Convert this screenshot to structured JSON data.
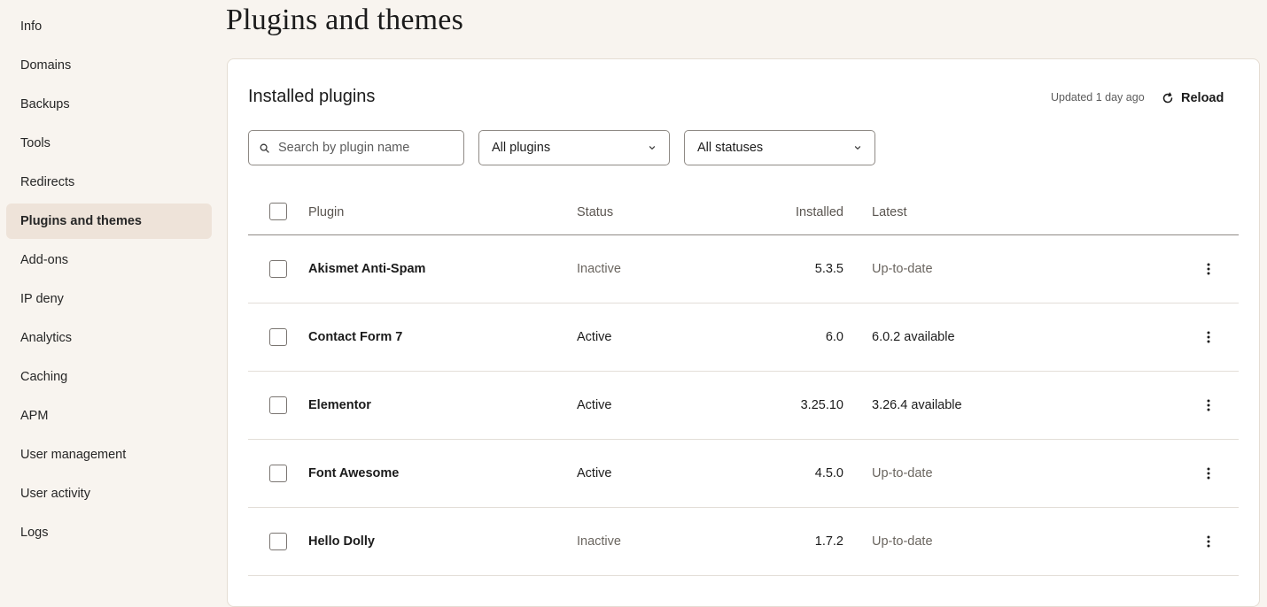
{
  "sidebar": {
    "items": [
      {
        "label": "Info",
        "active": false
      },
      {
        "label": "Domains",
        "active": false
      },
      {
        "label": "Backups",
        "active": false
      },
      {
        "label": "Tools",
        "active": false
      },
      {
        "label": "Redirects",
        "active": false
      },
      {
        "label": "Plugins and themes",
        "active": true
      },
      {
        "label": "Add-ons",
        "active": false
      },
      {
        "label": "IP deny",
        "active": false
      },
      {
        "label": "Analytics",
        "active": false
      },
      {
        "label": "Caching",
        "active": false
      },
      {
        "label": "APM",
        "active": false
      },
      {
        "label": "User management",
        "active": false
      },
      {
        "label": "User activity",
        "active": false
      },
      {
        "label": "Logs",
        "active": false
      }
    ]
  },
  "page": {
    "title": "Plugins and themes"
  },
  "card": {
    "title": "Installed plugins",
    "updated": "Updated 1 day ago",
    "reload_label": "Reload"
  },
  "filters": {
    "search_placeholder": "Search by plugin name",
    "plugin_filter": "All plugins",
    "status_filter": "All statuses"
  },
  "table": {
    "columns": {
      "plugin": "Plugin",
      "status": "Status",
      "installed": "Installed",
      "latest": "Latest"
    },
    "rows": [
      {
        "plugin": "Akismet Anti-Spam",
        "status": "Inactive",
        "installed": "5.3.5",
        "latest": "Up-to-date"
      },
      {
        "plugin": "Contact Form 7",
        "status": "Active",
        "installed": "6.0",
        "latest": "6.0.2 available"
      },
      {
        "plugin": "Elementor",
        "status": "Active",
        "installed": "3.25.10",
        "latest": "3.26.4 available"
      },
      {
        "plugin": "Font Awesome",
        "status": "Active",
        "installed": "4.5.0",
        "latest": "Up-to-date"
      },
      {
        "plugin": "Hello Dolly",
        "status": "Inactive",
        "installed": "1.7.2",
        "latest": "Up-to-date"
      }
    ]
  },
  "colors": {
    "page_background": "#f8f4ef",
    "sidebar_active": "#eee3d9",
    "card_background": "#ffffff",
    "text_primary": "#1b1b1b",
    "text_muted": "#6b6660"
  }
}
